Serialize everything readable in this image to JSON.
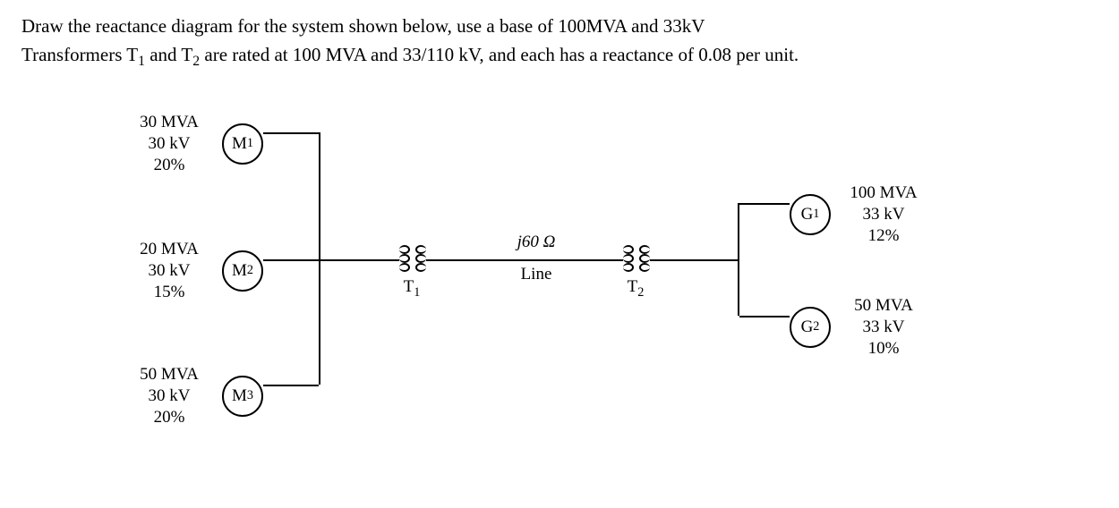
{
  "prompt": {
    "line1_a": "Draw the reactance diagram for the system shown below, use a base of 100MVA and 33kV",
    "line2_a": "Transformers T",
    "line2_sub1": "1",
    "line2_b": " and T",
    "line2_sub2": "2",
    "line2_c": " are rated at 100 MVA and 33/110 kV, and each has a reactance of 0.08 per unit."
  },
  "machines": {
    "m1": {
      "label_a": "M",
      "label_s": "1",
      "r1": "30 MVA",
      "r2": "30 kV",
      "r3": "20%"
    },
    "m2": {
      "label_a": "M",
      "label_s": "2",
      "r1": "20 MVA",
      "r2": "30 kV",
      "r3": "15%"
    },
    "m3": {
      "label_a": "M",
      "label_s": "3",
      "r1": "50 MVA",
      "r2": "30 kV",
      "r3": "20%"
    },
    "g1": {
      "label_a": "G",
      "label_s": "1",
      "r1": "100 MVA",
      "r2": "33 kV",
      "r3": "12%"
    },
    "g2": {
      "label_a": "G",
      "label_s": "2",
      "r1": "50 MVA",
      "r2": "33 kV",
      "r3": "10%"
    }
  },
  "transformers": {
    "t1": {
      "label_a": "T",
      "label_s": "1"
    },
    "t2": {
      "label_a": "T",
      "label_s": "2"
    }
  },
  "line": {
    "impedance": "j60 Ω",
    "label": "Line"
  },
  "chart_data": {
    "type": "table",
    "base": {
      "mva": 100,
      "kv": 33
    },
    "components": [
      {
        "id": "M1",
        "type": "motor",
        "mva": 30,
        "kv": 30,
        "x_pct": 20
      },
      {
        "id": "M2",
        "type": "motor",
        "mva": 20,
        "kv": 30,
        "x_pct": 15
      },
      {
        "id": "M3",
        "type": "motor",
        "mva": 50,
        "kv": 30,
        "x_pct": 20
      },
      {
        "id": "G1",
        "type": "generator",
        "mva": 100,
        "kv": 33,
        "x_pct": 12
      },
      {
        "id": "G2",
        "type": "generator",
        "mva": 50,
        "kv": 33,
        "x_pct": 10
      },
      {
        "id": "T1",
        "type": "transformer",
        "mva": 100,
        "kv_pri": 33,
        "kv_sec": 110,
        "x_pu": 0.08
      },
      {
        "id": "T2",
        "type": "transformer",
        "mva": 100,
        "kv_pri": 33,
        "kv_sec": 110,
        "x_pu": 0.08
      },
      {
        "id": "Line",
        "type": "line",
        "impedance_ohm": 60
      }
    ]
  }
}
